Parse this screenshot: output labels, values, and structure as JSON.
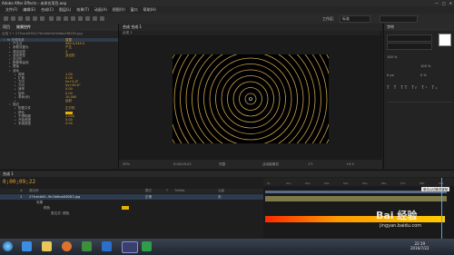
{
  "window": {
    "title": "Adobe After Effects - 未命名项目.aep"
  },
  "window_controls": [
    "—",
    "□",
    "✕"
  ],
  "menu": [
    "文件(F)",
    "编辑(E)",
    "合成(C)",
    "图层(L)",
    "效果(T)",
    "动画(A)",
    "视图(V)",
    "窗口",
    "帮助(H)"
  ],
  "toolbar": {
    "workspace_label": "工作区:",
    "workspace_value": "标准"
  },
  "left_panel": {
    "tab_project": "项目",
    "tab_effects": "效果控件",
    "path": "合成 1 • 27fcecb8f3227b0d4b9b7b6ba4f8283.jpg",
    "properties": [
      {
        "name": "fx 无线电波",
        "value": "重置",
        "level": 0,
        "expanded": true,
        "highlight": true
      },
      {
        "name": "产生点",
        "value": "960.0,540.0",
        "level": 1
      },
      {
        "name": "参数设置为",
        "value": "产生",
        "level": 1
      },
      {
        "name": "渲染品质",
        "value": "4",
        "level": 1
      },
      {
        "name": "波浪类型",
        "value": "多边形",
        "level": 1
      },
      {
        "name": "多边形",
        "value": "",
        "level": 1
      },
      {
        "name": "图像等高线",
        "value": "",
        "level": 1
      },
      {
        "name": "蒙版",
        "value": "",
        "level": 1
      },
      {
        "name": "波动",
        "value": "",
        "level": 1,
        "expanded": true
      },
      {
        "name": "频率",
        "value": "1.00",
        "level": 2
      },
      {
        "name": "扩展",
        "value": "5.00",
        "level": 2
      },
      {
        "name": "方向",
        "value": "0x+0.0°",
        "level": 2
      },
      {
        "name": "方向",
        "value": "0x+90.0°",
        "level": 2
      },
      {
        "name": "速率",
        "value": "0.00",
        "level": 2
      },
      {
        "name": "旋转",
        "value": "0.00",
        "level": 2
      },
      {
        "name": "寿命(秒)",
        "value": "10.000",
        "level": 2
      },
      {
        "name": "",
        "value": "反射",
        "level": 2
      },
      {
        "name": "描边",
        "value": "",
        "level": 1,
        "expanded": true
      },
      {
        "name": "配置文件",
        "value": "正方形",
        "level": 2
      },
      {
        "name": "颜色",
        "value": "",
        "level": 2,
        "swatch": true
      },
      {
        "name": "不透明度",
        "value": "1.000",
        "level": 2
      },
      {
        "name": "开始宽度",
        "value": "5.00",
        "level": 2
      },
      {
        "name": "末端宽度",
        "value": "5.00",
        "level": 2
      }
    ]
  },
  "comp": {
    "tab": "合成 合成 1",
    "subtab": "合成 1",
    "footer": [
      "25%",
      "0;00;09;22",
      "完整",
      "活动摄像机",
      "1个",
      "+0.0"
    ]
  },
  "right_panel": {
    "tab": "字符",
    "rows": [
      "100 %",
      "100 %",
      "0 px",
      "0 %"
    ]
  },
  "timeline": {
    "tab": "合成 1",
    "timecode": "0;00;09;22",
    "columns": [
      "#",
      "源名称",
      "模式",
      "T",
      "TrkMat",
      "父级"
    ],
    "layers": [
      {
        "num": "1",
        "name": "27fcecb8f...9b7b6ba4f8283.jpg",
        "mode": "正常",
        "parent": "无"
      },
      {
        "num": "",
        "name": "效果",
        "mode": "",
        "parent": ""
      },
      {
        "num": "",
        "name": "颜色",
        "mode": "",
        "parent": ""
      },
      {
        "num": "",
        "name": "表达式: 颜色",
        "mode": "",
        "parent": ""
      }
    ],
    "ruler_ticks": [
      "0s",
      "01s",
      "02s",
      "03s",
      "04s",
      "05s",
      "06s",
      "07s",
      "08s",
      "09s"
    ],
    "tooltip": "单击以切换关键帧"
  },
  "taskbar": {
    "time": "22:19",
    "date": "2016/7/22"
  },
  "watermark": {
    "brand": "Bai 经验",
    "url": "jingyan.baidu.com"
  },
  "colors": {
    "accent_orange": "#e8a020",
    "swatch": "#e8b200"
  }
}
